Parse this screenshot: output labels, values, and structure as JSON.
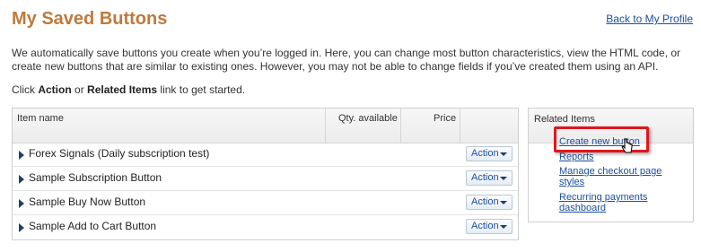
{
  "page": {
    "title": "My Saved Buttons",
    "back_link": "Back to My Profile",
    "intro": "We automatically save buttons you create when you’re logged in. Here, you can change most button characteristics, view the HTML code, or create new buttons that are similar to existing ones. However, you may not be able to change fields if you’ve created them using an API.",
    "instruction": {
      "prefix": "Click ",
      "action": "Action",
      "middle": " or ",
      "related": "Related Items",
      "suffix": " link to get started."
    }
  },
  "table": {
    "headers": {
      "name": "Item name",
      "qty": "Qty. available",
      "price": "Price"
    },
    "rows": [
      {
        "name": "Forex Signals (Daily subscription test)",
        "action": "Action"
      },
      {
        "name": "Sample Subscription Button",
        "action": "Action"
      },
      {
        "name": "Sample Buy Now Button",
        "action": "Action"
      },
      {
        "name": "Sample Add to Cart Button",
        "action": "Action"
      }
    ]
  },
  "related": {
    "title": "Related Items",
    "links": [
      "Create new button",
      "Reports",
      "Manage checkout page styles",
      "Recurring payments dashboard"
    ]
  },
  "colors": {
    "title": "#c0793a",
    "link": "#1a4f9c",
    "highlight": "#e0161c"
  }
}
